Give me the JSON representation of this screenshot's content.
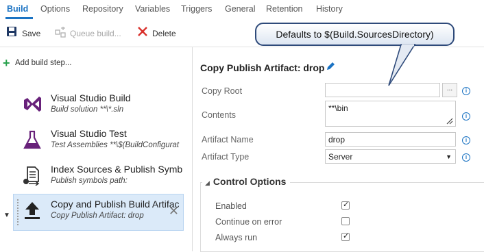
{
  "tabs": [
    {
      "label": "Build"
    },
    {
      "label": "Options"
    },
    {
      "label": "Repository"
    },
    {
      "label": "Variables"
    },
    {
      "label": "Triggers"
    },
    {
      "label": "General"
    },
    {
      "label": "Retention"
    },
    {
      "label": "History"
    }
  ],
  "toolbar": {
    "save_label": "Save",
    "queue_label": "Queue build...",
    "delete_label": "Delete"
  },
  "sidebar": {
    "add_step_label": "Add build step...",
    "steps": [
      {
        "title": "Visual Studio Build",
        "subtitle": "Build solution **\\*.sln",
        "icon": "visual-studio-icon"
      },
      {
        "title": "Visual Studio Test",
        "subtitle": "Test Assemblies **\\$(BuildConfigurat",
        "icon": "flask-icon"
      },
      {
        "title": "Index Sources & Publish Symb",
        "subtitle": "Publish symbols path:",
        "icon": "index-sources-icon"
      },
      {
        "title": "Copy and Publish Build Artifac",
        "subtitle": "Copy Publish Artifact: drop",
        "icon": "upload-icon"
      }
    ]
  },
  "main": {
    "task_title": "Copy Publish Artifact: drop",
    "fields": {
      "copy_root": {
        "label": "Copy Root",
        "value": ""
      },
      "contents": {
        "label": "Contents",
        "value": "**\\bin"
      },
      "artifact_name": {
        "label": "Artifact Name",
        "value": "drop"
      },
      "artifact_type": {
        "label": "Artifact Type",
        "value": "Server"
      }
    },
    "browse_label": "...",
    "control_options": {
      "title": "Control Options",
      "options": [
        {
          "label": "Enabled",
          "checked": true
        },
        {
          "label": "Continue on error",
          "checked": false
        },
        {
          "label": "Always run",
          "checked": true
        }
      ]
    }
  },
  "callout": {
    "text": "Defaults to $(Build.SourcesDirectory)"
  },
  "colors": {
    "accent": "#1b73c3",
    "add_green": "#2aa24e",
    "selected_bg": "#dbeaf9",
    "delete_red": "#d9302a"
  }
}
